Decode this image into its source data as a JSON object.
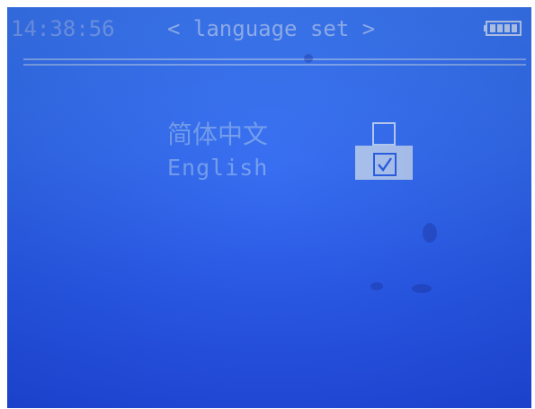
{
  "status_bar": {
    "clock": "14:38:56",
    "title": "< language set >",
    "battery_level": 1.0
  },
  "languages": [
    {
      "label": "简体中文",
      "checked": false
    },
    {
      "label": "English",
      "checked": true,
      "selected": true
    }
  ],
  "colors": {
    "screen_background": "#2f69f1",
    "text": "#6f9bf0",
    "highlight": "#a9c2f2"
  },
  "icons": {
    "battery": "battery-full-icon",
    "unchecked": "checkbox-empty-icon",
    "checked": "checkbox-checked-icon"
  }
}
